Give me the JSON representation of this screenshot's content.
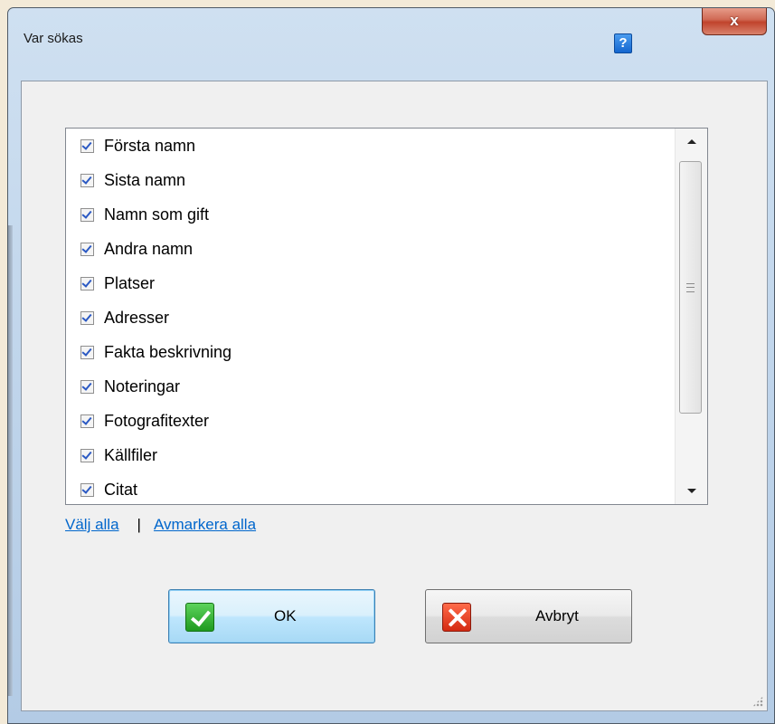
{
  "window": {
    "title": "Var sökas",
    "help_label": "?",
    "close_label": "x"
  },
  "list": {
    "items": [
      {
        "label": "Första namn",
        "checked": true
      },
      {
        "label": "Sista namn",
        "checked": true
      },
      {
        "label": "Namn som gift",
        "checked": true
      },
      {
        "label": "Andra namn",
        "checked": true
      },
      {
        "label": "Platser",
        "checked": true
      },
      {
        "label": "Adresser",
        "checked": true
      },
      {
        "label": "Fakta beskrivning",
        "checked": true
      },
      {
        "label": "Noteringar",
        "checked": true
      },
      {
        "label": "Fotografitexter",
        "checked": true
      },
      {
        "label": "Källfiler",
        "checked": true
      },
      {
        "label": "Citat",
        "checked": true
      }
    ]
  },
  "links": {
    "select_all": "Välj alla",
    "separator": "|",
    "deselect_all": "Avmarkera alla"
  },
  "buttons": {
    "ok_label": "OK",
    "cancel_label": "Avbryt"
  },
  "colors": {
    "link": "#0066cc",
    "ok_icon": "#1f9a1f",
    "cancel_icon": "#d42a12",
    "close_button": "#c0432c"
  }
}
